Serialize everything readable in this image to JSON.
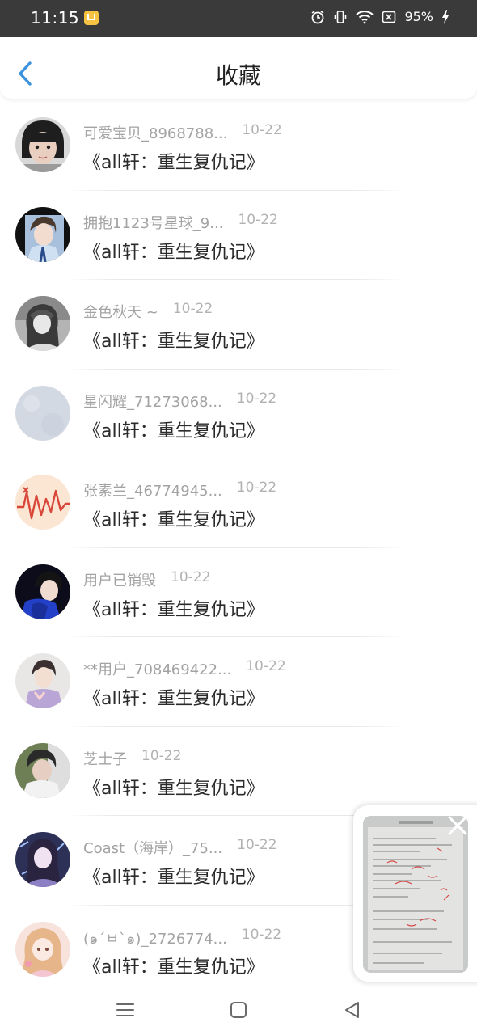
{
  "status_bar": {
    "time": "11:15",
    "battery_percent": "95%",
    "icons": [
      "app-notification-icon",
      "alarm-icon",
      "vibrate-icon",
      "wifi-icon",
      "sim-off-icon",
      "charging-icon"
    ]
  },
  "header": {
    "title": "收藏",
    "back_icon": "chevron-left-icon",
    "accent_color": "#3a92de"
  },
  "items": [
    {
      "user": "可爱宝贝_8968788...",
      "date": "10-22",
      "title": "《all轩：重生复仇记》",
      "avatar_color": "#cfcfcf"
    },
    {
      "user": "拥抱1123号星球_9...",
      "date": "10-22",
      "title": "《all轩：重生复仇记》",
      "avatar_color": "#8da7c7"
    },
    {
      "user": "金色秋天 ~",
      "date": "10-22",
      "title": "《all轩：重生复仇记》",
      "avatar_color": "#9b9b9b"
    },
    {
      "user": "星闪耀_71273068...",
      "date": "10-22",
      "title": "《all轩：重生复仇记》",
      "avatar_color": "#d3d9e2"
    },
    {
      "user": "张素兰_46774945...",
      "date": "10-22",
      "title": "《all轩：重生复仇记》",
      "avatar_color": "#fbe6d3"
    },
    {
      "user": "用户已销毁",
      "date": "10-22",
      "title": "《all轩：重生复仇记》",
      "avatar_color": "#1b2a8c"
    },
    {
      "user": "**用户_708469422...",
      "date": "10-22",
      "title": "《all轩：重生复仇记》",
      "avatar_color": "#d7c5c5"
    },
    {
      "user": "芝士子",
      "date": "10-22",
      "title": "《all轩：重生复仇记》",
      "avatar_color": "#5a6a48"
    },
    {
      "user": "Coast（海岸）_75...",
      "date": "10-22",
      "title": "《all轩：重生复仇记》",
      "avatar_color": "#3b3f6b"
    },
    {
      "user": "(๑´ㅂ`๑)_2726774...",
      "date": "10-22",
      "title": "《all轩：重生复仇记》",
      "avatar_color": "#f3d5c8"
    }
  ],
  "floating_window": {
    "close_icon": "close-icon",
    "content": "document-preview"
  },
  "nav_bar": {
    "icons": [
      "menu-icon",
      "home-icon",
      "back-icon"
    ]
  }
}
